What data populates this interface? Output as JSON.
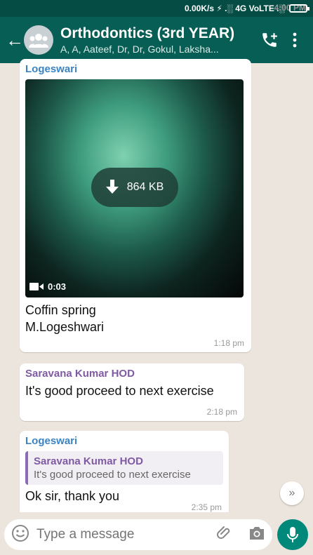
{
  "status": {
    "time": "4:00 PM",
    "right": "0.00K/s ⚡ .░ 4G VoLTE .░"
  },
  "header": {
    "title": "Orthodontics (3rd YEAR)",
    "subtitle": "A, A, Aateef, Dr, Dr, Gokul, Laksha..."
  },
  "messages": [
    {
      "sender": "Logeswari",
      "video": {
        "size": "864 KB",
        "duration": "0:03"
      },
      "caption_line1": "Coffin spring",
      "caption_line2": "M.Logeshwari",
      "time": "1:18 pm"
    },
    {
      "sender": "Saravana Kumar HOD",
      "text": "It's good proceed to next exercise",
      "time": "2:18 pm"
    },
    {
      "sender": "Logeswari",
      "quote": {
        "name": "Saravana Kumar HOD",
        "text": "It's good proceed to next exercise"
      },
      "text": "Ok sir, thank you",
      "time": "2:35 pm"
    }
  ],
  "input": {
    "placeholder": "Type a message"
  },
  "colors": {
    "header": "#075e54",
    "accent": "#00897b",
    "chat_bg": "#ece5dd"
  },
  "icons": [
    "back-arrow",
    "group-avatar",
    "add-call",
    "more-vert",
    "download",
    "video-camera",
    "scroll-down",
    "emoji",
    "attach",
    "camera",
    "mic"
  ]
}
